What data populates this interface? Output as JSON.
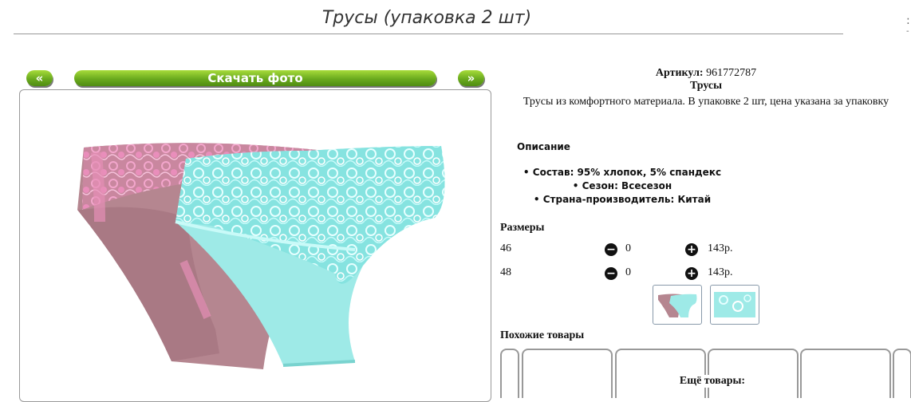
{
  "product": {
    "title": "Трусы (упаковка 2 шт)",
    "article_label": "Артикул:",
    "article_value": "961772787",
    "name": "Трусы",
    "short_description": "Трусы из комфортного материала. В упаковке 2 шт, цена указана за упаковку"
  },
  "gallery": {
    "prev_label": "«",
    "download_label": "Скачать фото",
    "next_label": "»"
  },
  "description": {
    "heading": "Описание",
    "properties": [
      "Состав: 95% хлопок, 5% спандекс",
      "Сезон: Всесезон",
      "Страна-производитель: Китай"
    ]
  },
  "sizes": {
    "heading": "Размеры",
    "rows": [
      {
        "size": "46",
        "qty": "0",
        "price": "143р."
      },
      {
        "size": "48",
        "qty": "0",
        "price": "143р."
      }
    ]
  },
  "similar": {
    "heading": "Похожие товары",
    "more_label": "Ещё товары:"
  },
  "icons": {
    "minus": "minus-circle-icon",
    "plus": "plus-circle-icon"
  },
  "colors": {
    "button_green": "#6aaa1e",
    "mauve": "#b58690",
    "lace_pink": "#e58fb6",
    "aqua": "#8fe6e2"
  }
}
